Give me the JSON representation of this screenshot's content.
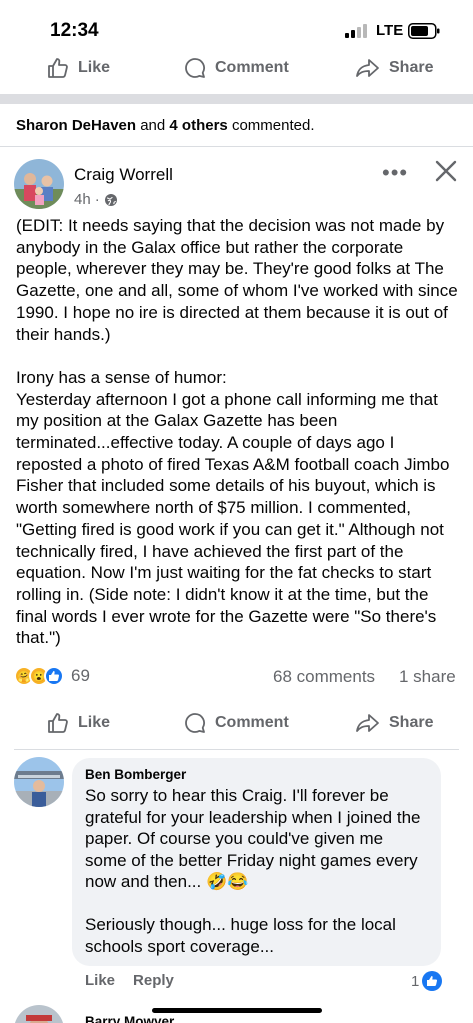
{
  "status_bar": {
    "time": "12:34",
    "network": "LTE"
  },
  "top_actions": {
    "like": "Like",
    "comment": "Comment",
    "share": "Share"
  },
  "commented_line": {
    "name": "Sharon DeHaven",
    "and": " and ",
    "others": "4 others",
    "suffix": " commented."
  },
  "post": {
    "author": "Craig Worrell",
    "time": "4h",
    "text": "(EDIT: It needs saying that the decision was not made by anybody in the Galax office but rather the corporate people, wherever they may be. They're good folks at The Gazette, one and all, some of whom I've worked with since 1990. I hope no ire is directed at them because it is out of their hands.)\n\nIrony has a sense of humor:\nYesterday afternoon I got a phone call informing me that my position at the Galax Gazette has been terminated...effective today. A couple of days ago I reposted a photo of fired Texas A&M football coach Jimbo Fisher that included some details of his buyout, which is worth somewhere north of $75 million. I commented, \"Getting fired is good work if you can get it.\" Although not technically fired, I have achieved the first part of the equation. Now I'm just waiting for the fat checks to start rolling in. (Side note: I didn't know it at the time, but the final words I ever wrote for the Gazette were \"So there's that.\")",
    "reaction_count": "69",
    "comments_count": "68 comments",
    "shares_count": "1 share"
  },
  "bottom_actions": {
    "like": "Like",
    "comment": "Comment",
    "share": "Share"
  },
  "comment": {
    "author": "Ben Bomberger",
    "text": "So sorry to hear this Craig. I'll forever be grateful for your leadership when I joined the paper. Of course you could've given me some of the better Friday night games every now and then... 🤣😂\n\nSeriously though... huge loss for the local schools sport coverage...",
    "like_label": "Like",
    "reply_label": "Reply",
    "likes": "1"
  },
  "next_comment": {
    "author": "Barry Mowyer"
  },
  "colors": {
    "accent": "#1877f2",
    "muted": "#65676b",
    "bubble": "#f0f2f5"
  }
}
